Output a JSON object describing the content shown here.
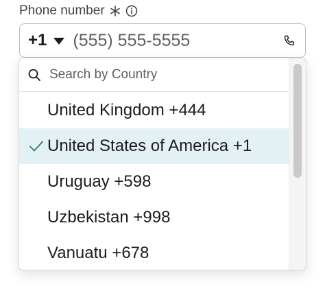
{
  "field": {
    "label": "Phone number",
    "country_code": "+1",
    "placeholder": "(555) 555-5555"
  },
  "dropdown": {
    "search_placeholder": "Search by Country",
    "items": [
      {
        "label": "United Kingdom +444",
        "selected": false
      },
      {
        "label": "United States of America +1",
        "selected": true
      },
      {
        "label": "Uruguay +598",
        "selected": false
      },
      {
        "label": "Uzbekistan +998",
        "selected": false
      },
      {
        "label": "Vanuatu +678",
        "selected": false
      }
    ]
  },
  "colors": {
    "selected_row": "#e3f1f4",
    "checkmark": "#2e7d5b",
    "text": "#1d1c1d",
    "muted_text": "#616061"
  },
  "icons": {
    "required": "asterisk-icon",
    "info": "info-icon",
    "dropdown": "caret-down-icon",
    "phone": "phone-icon",
    "search": "search-icon",
    "check": "check-icon"
  }
}
